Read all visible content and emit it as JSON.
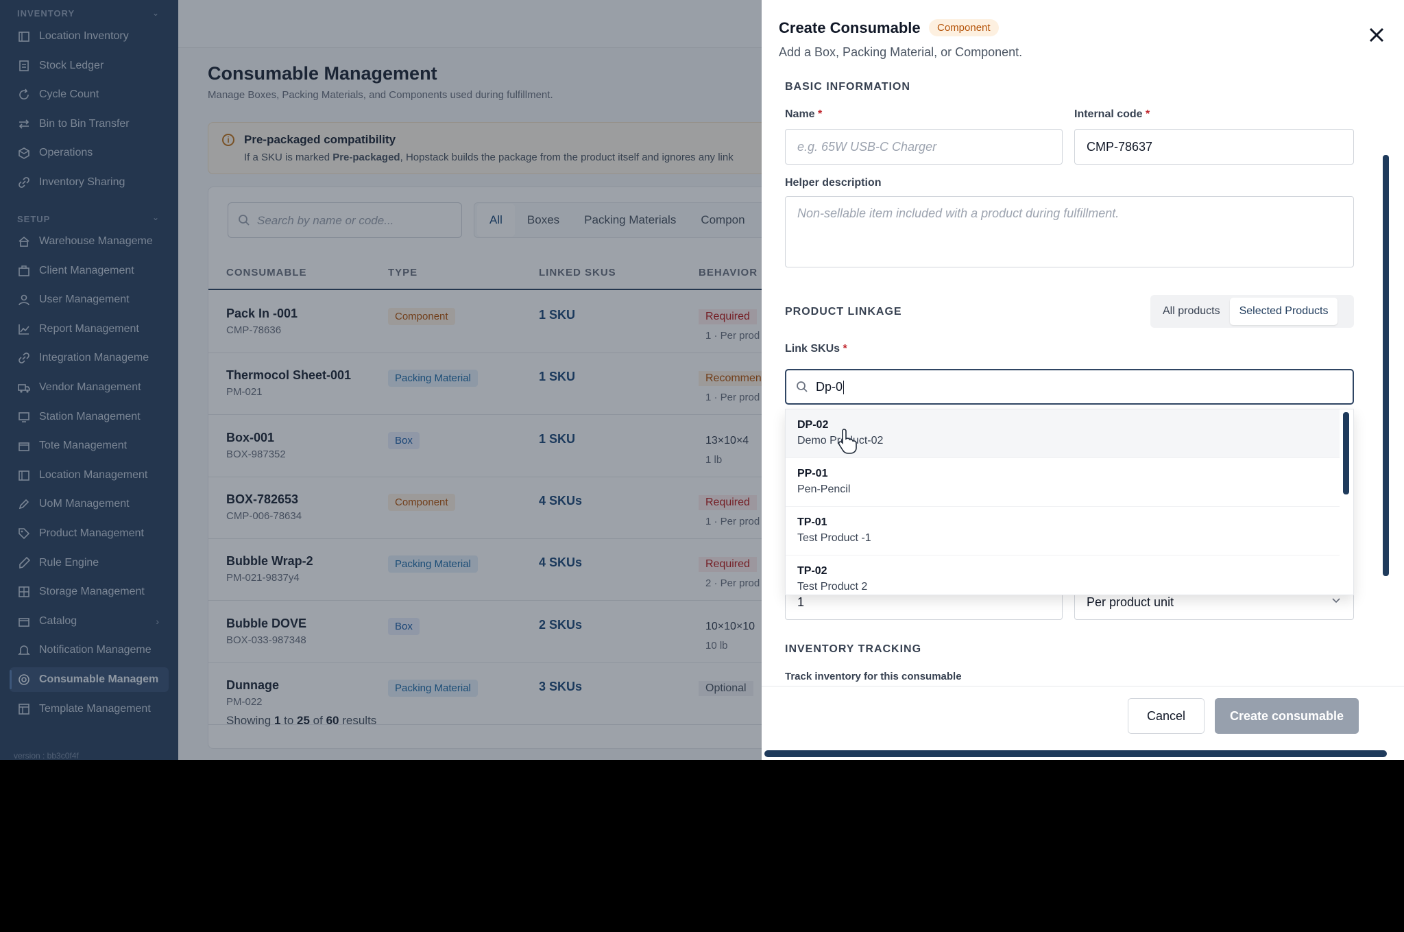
{
  "sidebar": {
    "inventory_heading": "INVENTORY",
    "setup_heading": "SETUP",
    "inventory_items": [
      "Location Inventory",
      "Stock Ledger",
      "Cycle Count",
      "Bin to Bin Transfer",
      "Operations",
      "Inventory Sharing"
    ],
    "setup_items": [
      "Warehouse Manageme",
      "Client Management",
      "User Management",
      "Report Management",
      "Integration Manageme",
      "Vendor Management",
      "Station Management",
      "Tote Management",
      "Location Management",
      "UoM Management",
      "Product Management",
      "Rule Engine",
      "Storage Management",
      "Catalog",
      "Notification Manageme",
      "Consumable Managem",
      "Template Management"
    ],
    "active_item": "Consumable Managem",
    "footer": "version : bb3c0f4f"
  },
  "main": {
    "title": "Consumable Management",
    "subtitle": "Manage Boxes, Packing Materials, and Components used during fulfillment.",
    "notice": {
      "title": "Pre-packaged compatibility",
      "text_prefix": "If a SKU is marked ",
      "text_bold": "Pre-packaged",
      "text_suffix": ", Hopstack builds the package from the product itself and ignores any link"
    },
    "search_placeholder": "Search by name or code...",
    "tabs": [
      "All",
      "Boxes",
      "Packing Materials",
      "Compon"
    ],
    "active_tab": "All",
    "columns": [
      "CONSUMABLE",
      "TYPE",
      "LINKED SKUS",
      "BEHAVIOR"
    ],
    "rows": [
      {
        "name": "Pack In -001",
        "code": "CMP-78636",
        "type": "Component",
        "skus": "1 SKU",
        "behavior": "Required",
        "detail": "1 · Per prod"
      },
      {
        "name": "Thermocol Sheet-001",
        "code": "PM-021",
        "type": "Packing Material",
        "skus": "1 SKU",
        "behavior": "Recommen",
        "detail": "1 · Per prod"
      },
      {
        "name": "Box-001",
        "code": "BOX-987352",
        "type": "Box",
        "skus": "1 SKU",
        "behavior": "13×10×4",
        "detail": "1 lb"
      },
      {
        "name": "BOX-782653",
        "code": "CMP-006-78634",
        "type": "Component",
        "skus": "4 SKUs",
        "behavior": "Required",
        "detail": "1 · Per prod"
      },
      {
        "name": "Bubble Wrap-2",
        "code": "PM-021-9837y4",
        "type": "Packing Material",
        "skus": "4 SKUs",
        "behavior": "Required",
        "detail": "2 · Per prod"
      },
      {
        "name": "Bubble DOVE",
        "code": "BOX-033-987348",
        "type": "Box",
        "skus": "2 SKUs",
        "behavior": "10×10×10",
        "detail": "10 lb"
      },
      {
        "name": "Dunnage",
        "code": "PM-022",
        "type": "Packing Material",
        "skus": "3 SKUs",
        "behavior": "Optional",
        "detail": ""
      }
    ],
    "pager": {
      "prefix": "Showing ",
      "from": "1",
      "to_word": " to ",
      "to": "25",
      "of_word": " of ",
      "total": "60",
      "suffix": " results"
    }
  },
  "drawer": {
    "title": "Create Consumable",
    "badge": "Component",
    "subtitle": "Add a Box, Packing Material, or Component.",
    "basic_heading": "BASIC INFORMATION",
    "name_label": "Name",
    "name_placeholder": "e.g. 65W USB-C Charger",
    "code_label": "Internal code",
    "code_value": "CMP-78637",
    "helper_label": "Helper description",
    "helper_placeholder": "Non-sellable item included with a product during fulfillment.",
    "linkage_heading": "PRODUCT LINKAGE",
    "linkage_options": [
      "All products",
      "Selected Products"
    ],
    "linkage_selected": "Selected Products",
    "link_label": "Link SKUs",
    "sku_query": "Dp-0",
    "options": [
      {
        "code": "DP-02",
        "name": "Demo Product-02"
      },
      {
        "code": "PP-01",
        "name": "Pen-Pencil"
      },
      {
        "code": "TP-01",
        "name": "Test Product -1"
      },
      {
        "code": "TP-02",
        "name": "Test Product 2"
      }
    ],
    "quantity_value": "1",
    "per_value": "Per product unit",
    "tracking_heading": "INVENTORY TRACKING",
    "tracking_label": "Track inventory for this consumable",
    "cancel": "Cancel",
    "create": "Create consumable"
  }
}
